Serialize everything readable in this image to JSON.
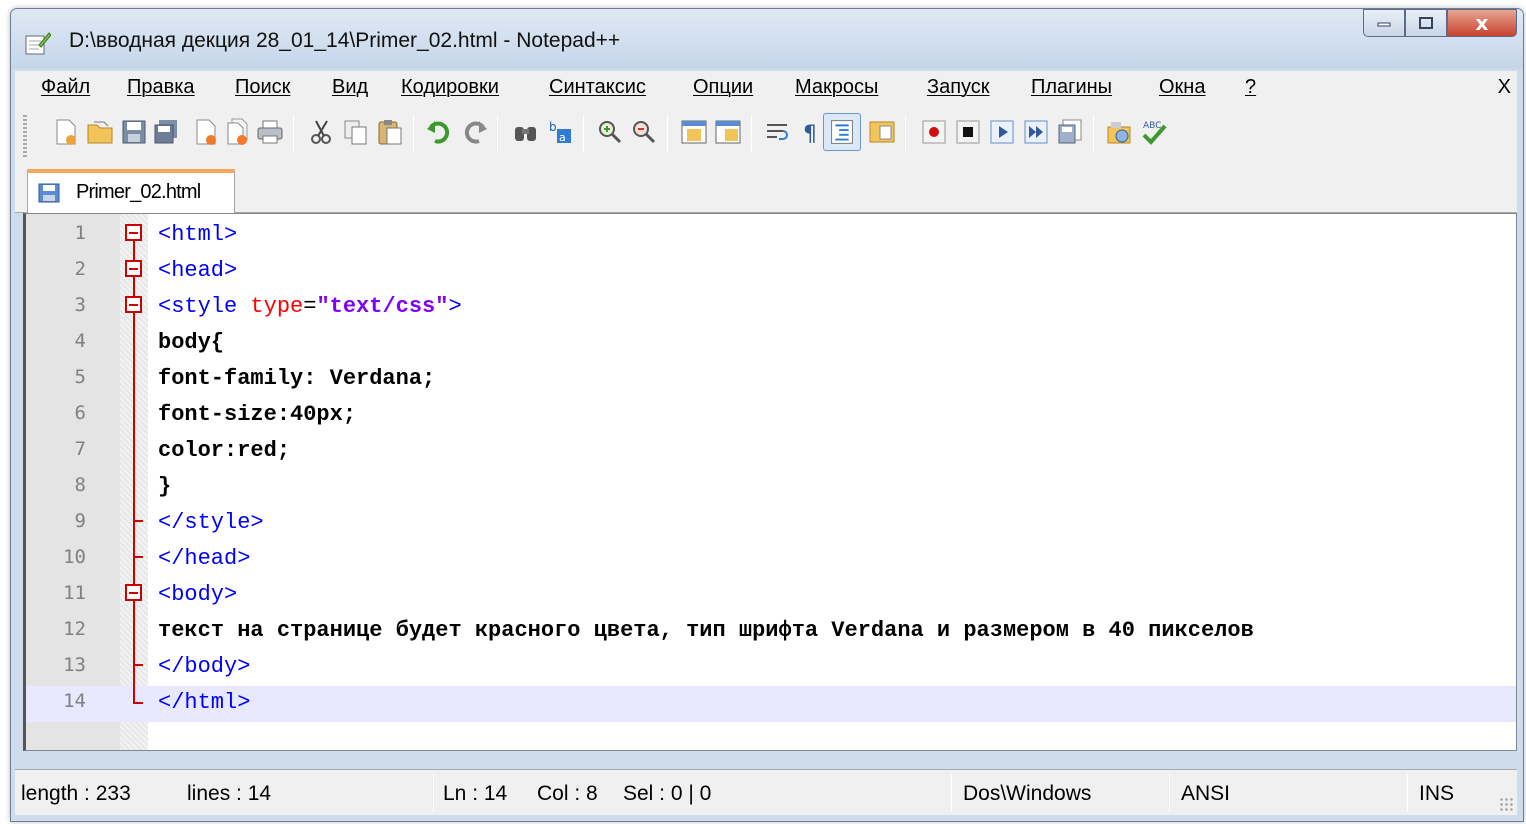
{
  "window": {
    "title": "D:\\вводная декция 28_01_14\\Primer_02.html - Notepad++",
    "close_symbol": "x"
  },
  "menubar": {
    "items": [
      "Файл",
      "Правка",
      "Поиск",
      "Вид",
      "Кодировки",
      "Синтаксис",
      "Опции",
      "Макросы",
      "Запуск",
      "Плагины",
      "Окна",
      "?"
    ],
    "close_label": "X"
  },
  "toolbar": {
    "icons": [
      "new-file-icon",
      "open-file-icon",
      "save-icon",
      "save-all-icon",
      "close-icon",
      "close-all-icon",
      "print-icon",
      "cut-icon",
      "copy-icon",
      "paste-icon",
      "undo-icon",
      "redo-icon",
      "find-icon",
      "replace-icon",
      "zoom-in-icon",
      "zoom-out-icon",
      "sync-vertical-icon",
      "sync-horizontal-icon",
      "word-wrap-icon",
      "show-all-chars-icon",
      "indent-guide-icon",
      "doc-map-icon",
      "record-macro-icon",
      "stop-macro-icon",
      "play-macro-icon",
      "run-macro-multiple-icon",
      "save-macro-icon",
      "plugin-icon",
      "spell-check-icon"
    ]
  },
  "tab": {
    "label": "Primer_02.html"
  },
  "editor": {
    "current_line": 14,
    "lines": [
      {
        "n": "1",
        "code": "<html>"
      },
      {
        "n": "2",
        "code": "<head>"
      },
      {
        "n": "3",
        "code": "<style type=\"text/css\">"
      },
      {
        "n": "4",
        "code": "body{"
      },
      {
        "n": "5",
        "code": "font-family: Verdana;"
      },
      {
        "n": "6",
        "code": "font-size:40px;"
      },
      {
        "n": "7",
        "code": "color:red;"
      },
      {
        "n": "8",
        "code": "}"
      },
      {
        "n": "9",
        "code": "</style>"
      },
      {
        "n": "10",
        "code": "</head>"
      },
      {
        "n": "11",
        "code": "<body>"
      },
      {
        "n": "12",
        "code": "текст на странице будет красного цвета, тип шрифта Verdana и размером в 40 пикселов"
      },
      {
        "n": "13",
        "code": "</body>"
      },
      {
        "n": "14",
        "code": "</html>"
      }
    ]
  },
  "statusbar": {
    "length": "length : 233",
    "lines": "lines : 14",
    "ln": "Ln : 14",
    "col": "Col : 8",
    "sel": "Sel : 0 | 0",
    "eol": "Dos\\Windows",
    "encoding": "ANSI",
    "mode": "INS"
  },
  "colors": {
    "tag": "#0000ff",
    "attribute": "#ff0000",
    "string": "#8000ff",
    "fold": "#d00000",
    "current_line": "#e8e8ff",
    "tab_accent": "#f9a85b"
  }
}
